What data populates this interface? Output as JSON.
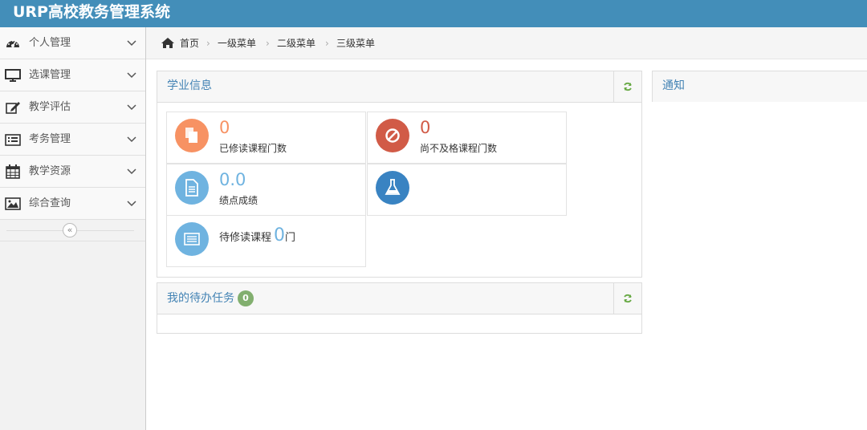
{
  "app": {
    "title": "URP高校教务管理系统"
  },
  "sidebar": {
    "items": [
      {
        "label": "个人管理",
        "icon": "dashboard-icon"
      },
      {
        "label": "选课管理",
        "icon": "monitor-icon"
      },
      {
        "label": "教学评估",
        "icon": "edit-icon"
      },
      {
        "label": "考务管理",
        "icon": "list-icon"
      },
      {
        "label": "教学资源",
        "icon": "calendar-icon"
      },
      {
        "label": "综合查询",
        "icon": "picture-icon"
      }
    ],
    "collapse_glyph": "«"
  },
  "breadcrumb": {
    "items": [
      "首页",
      "一级菜单",
      "二级菜单",
      "三级菜单"
    ],
    "separator": "›"
  },
  "academic": {
    "title": "学业信息",
    "completed_courses": {
      "value": "0",
      "label": "已修读课程门数",
      "color": "#f79263",
      "icon": "copy-icon"
    },
    "failed_courses": {
      "value": "0",
      "label": "尚不及格课程门数",
      "color": "#d15b47",
      "icon": "ban-icon"
    },
    "gpa": {
      "value": "0.0",
      "label": "绩点成绩",
      "color": "#6fb3e0",
      "icon": "file-icon"
    },
    "lab": {
      "color": "#3983c2",
      "icon": "flask-icon"
    },
    "pending": {
      "label": "待修读课程",
      "value": "0",
      "unit": "门",
      "color": "#6fb3e0",
      "icon": "list-alt-icon"
    }
  },
  "tasks": {
    "title": "我的待办任务",
    "count": "0",
    "badge_color": "#82af6f"
  },
  "notice": {
    "title": "通知"
  },
  "colors": {
    "topbar": "#438eb9",
    "accent": "#4383b4",
    "refresh": "#69aa46"
  }
}
